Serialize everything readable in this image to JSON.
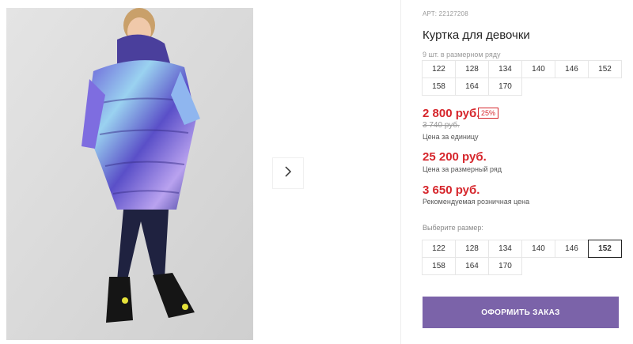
{
  "product": {
    "article": "АРТ: 22127208",
    "title": "Куртка для девочки",
    "pack_count": "9 шт. в размерном ряду"
  },
  "size_row": [
    "122",
    "128",
    "134",
    "140",
    "146",
    "152",
    "158",
    "164",
    "170"
  ],
  "prices": {
    "unit_price": "2 800 руб.",
    "discount": "25%",
    "old_price": "3 740 руб.",
    "unit_label": "Цена за единицу",
    "row_price": "25 200 руб.",
    "row_label": "Цена за размерный ряд",
    "retail_price": "3 650 руб.",
    "retail_label": "Рекомендуемая розничная цена"
  },
  "size_select": {
    "label": "Выберите размер:",
    "options": [
      "122",
      "128",
      "134",
      "140",
      "146",
      "152",
      "158",
      "164",
      "170"
    ],
    "selected": "152"
  },
  "order_button": "ОФОРМИТЬ ЗАКАЗ",
  "gallery": {
    "next_icon": "chevron-right-icon"
  },
  "colors": {
    "price_red": "#d6262c",
    "button_purple": "#7b63a9"
  }
}
